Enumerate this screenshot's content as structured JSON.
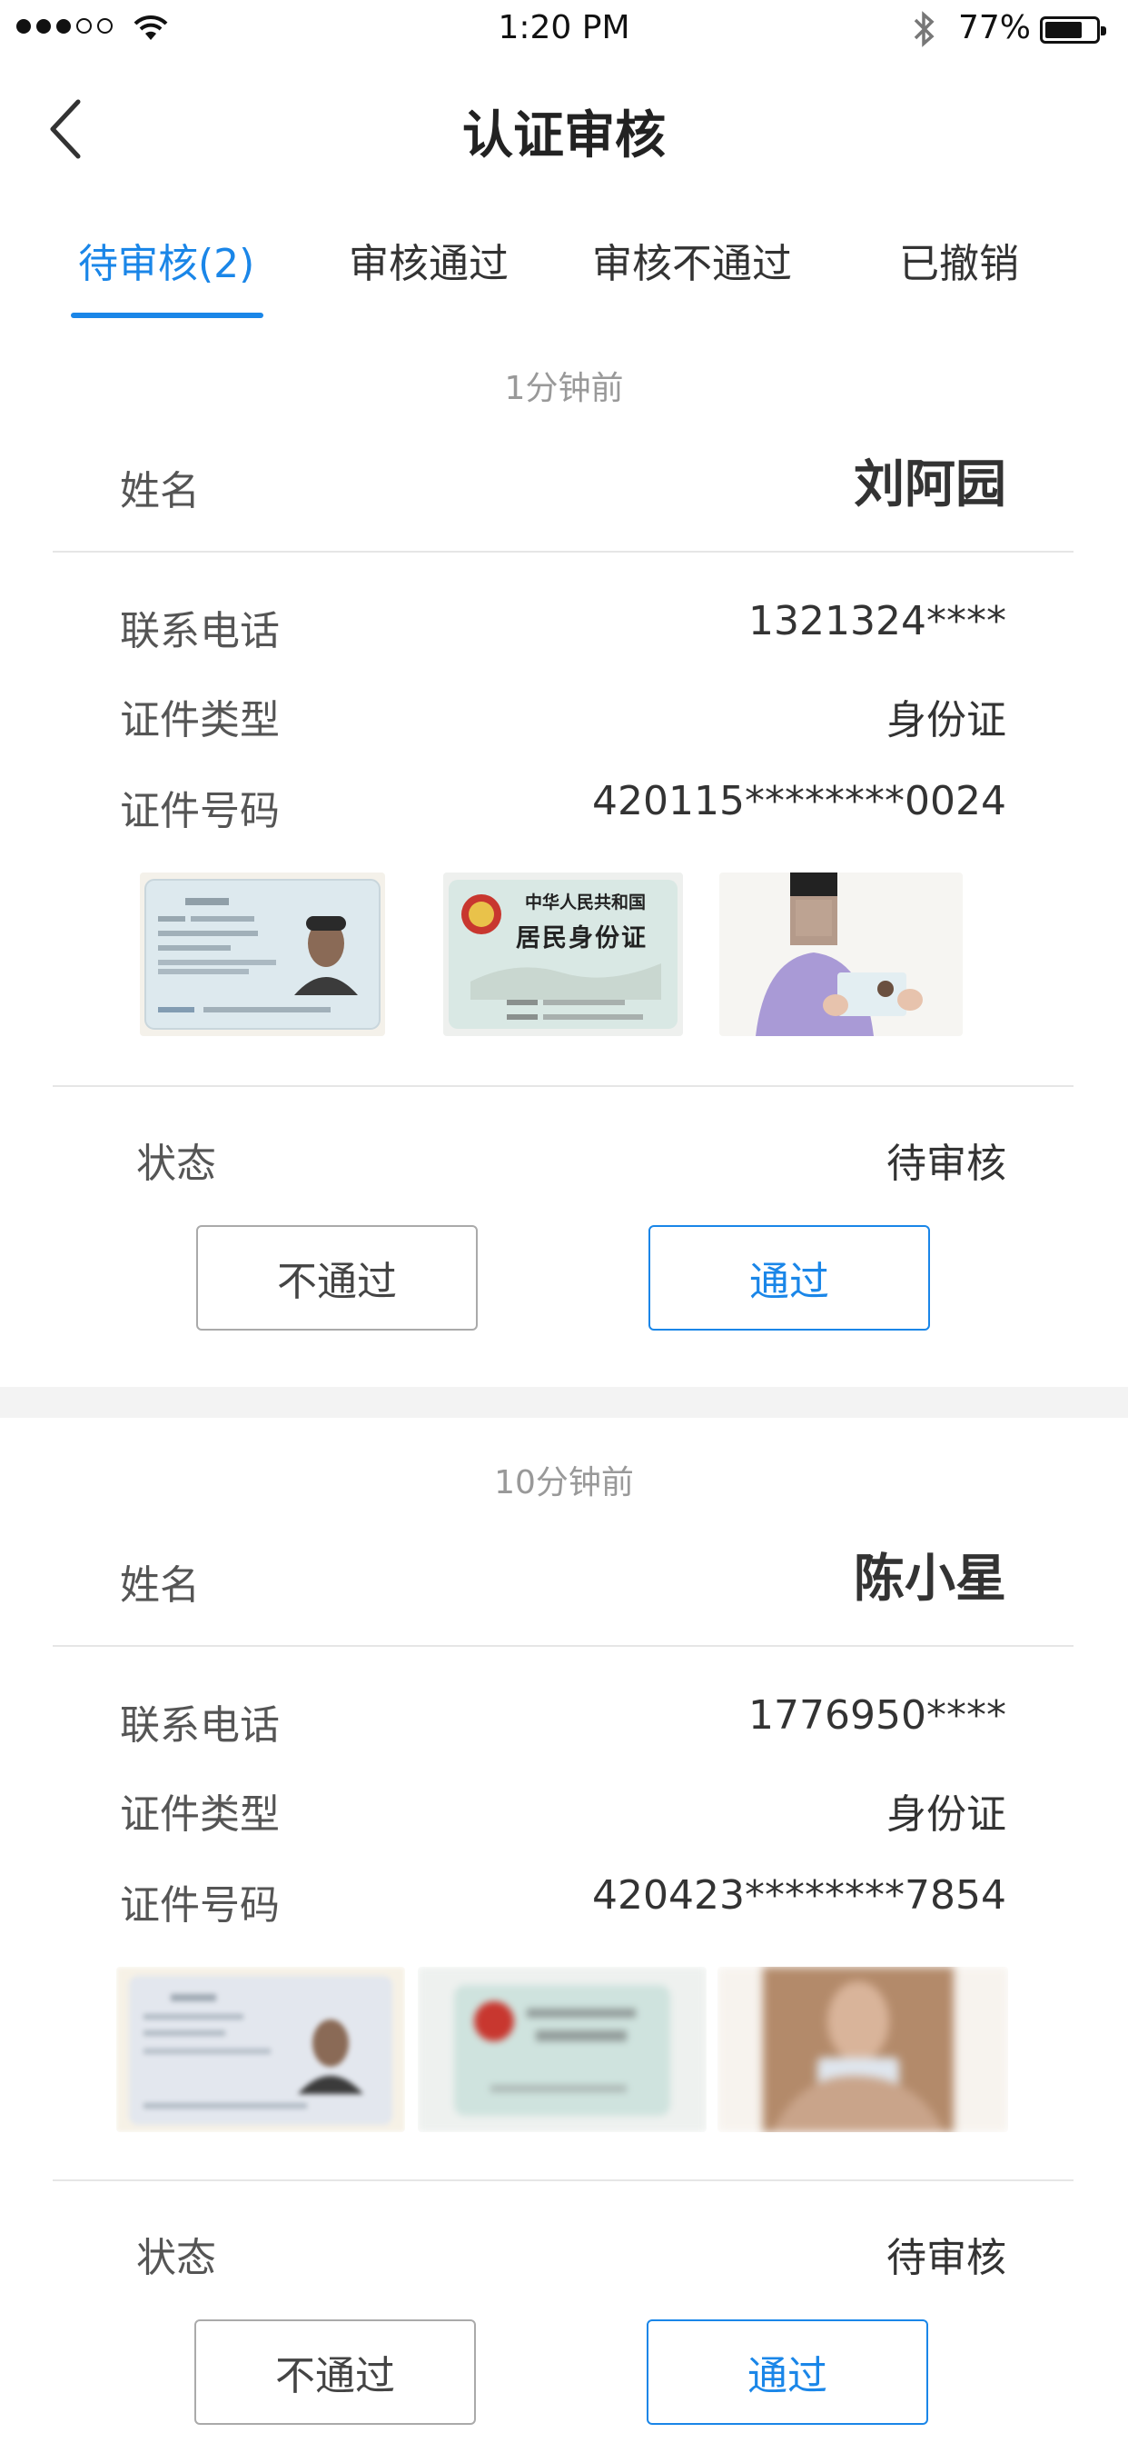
{
  "statusbar": {
    "time": "1:20 PM",
    "battery": "77%",
    "battery_level": 0.77
  },
  "header": {
    "title": "认证审核"
  },
  "tabs": [
    {
      "label": "待审核(2)"
    },
    {
      "label": "审核通过"
    },
    {
      "label": "审核不通过"
    },
    {
      "label": "已撤销"
    }
  ],
  "labels": {
    "name": "姓名",
    "phone": "联系电话",
    "id_type": "证件类型",
    "id_number": "证件号码",
    "status": "状态",
    "reject": "不通过",
    "approve": "通过"
  },
  "records": [
    {
      "time_ago": "1分钟前",
      "name": "刘阿园",
      "phone": "1321324****",
      "id_type": "身份证",
      "id_number": "420115********0024",
      "status": "待审核",
      "photos": [
        "id-card-front",
        "id-card-back",
        "holding-id-card"
      ],
      "id_back_text": {
        "line1": "中华人民共和国",
        "line2": "居民身份证"
      }
    },
    {
      "time_ago": "10分钟前",
      "name": "陈小星",
      "phone": "1776950****",
      "id_type": "身份证",
      "id_number": "420423********7854",
      "status": "待审核",
      "photos": [
        "id-card-front",
        "id-card-back",
        "holding-id-card"
      ]
    }
  ],
  "colors": {
    "accent": "#1a86e8",
    "divider": "#e6e6e6",
    "muted": "#999999"
  }
}
